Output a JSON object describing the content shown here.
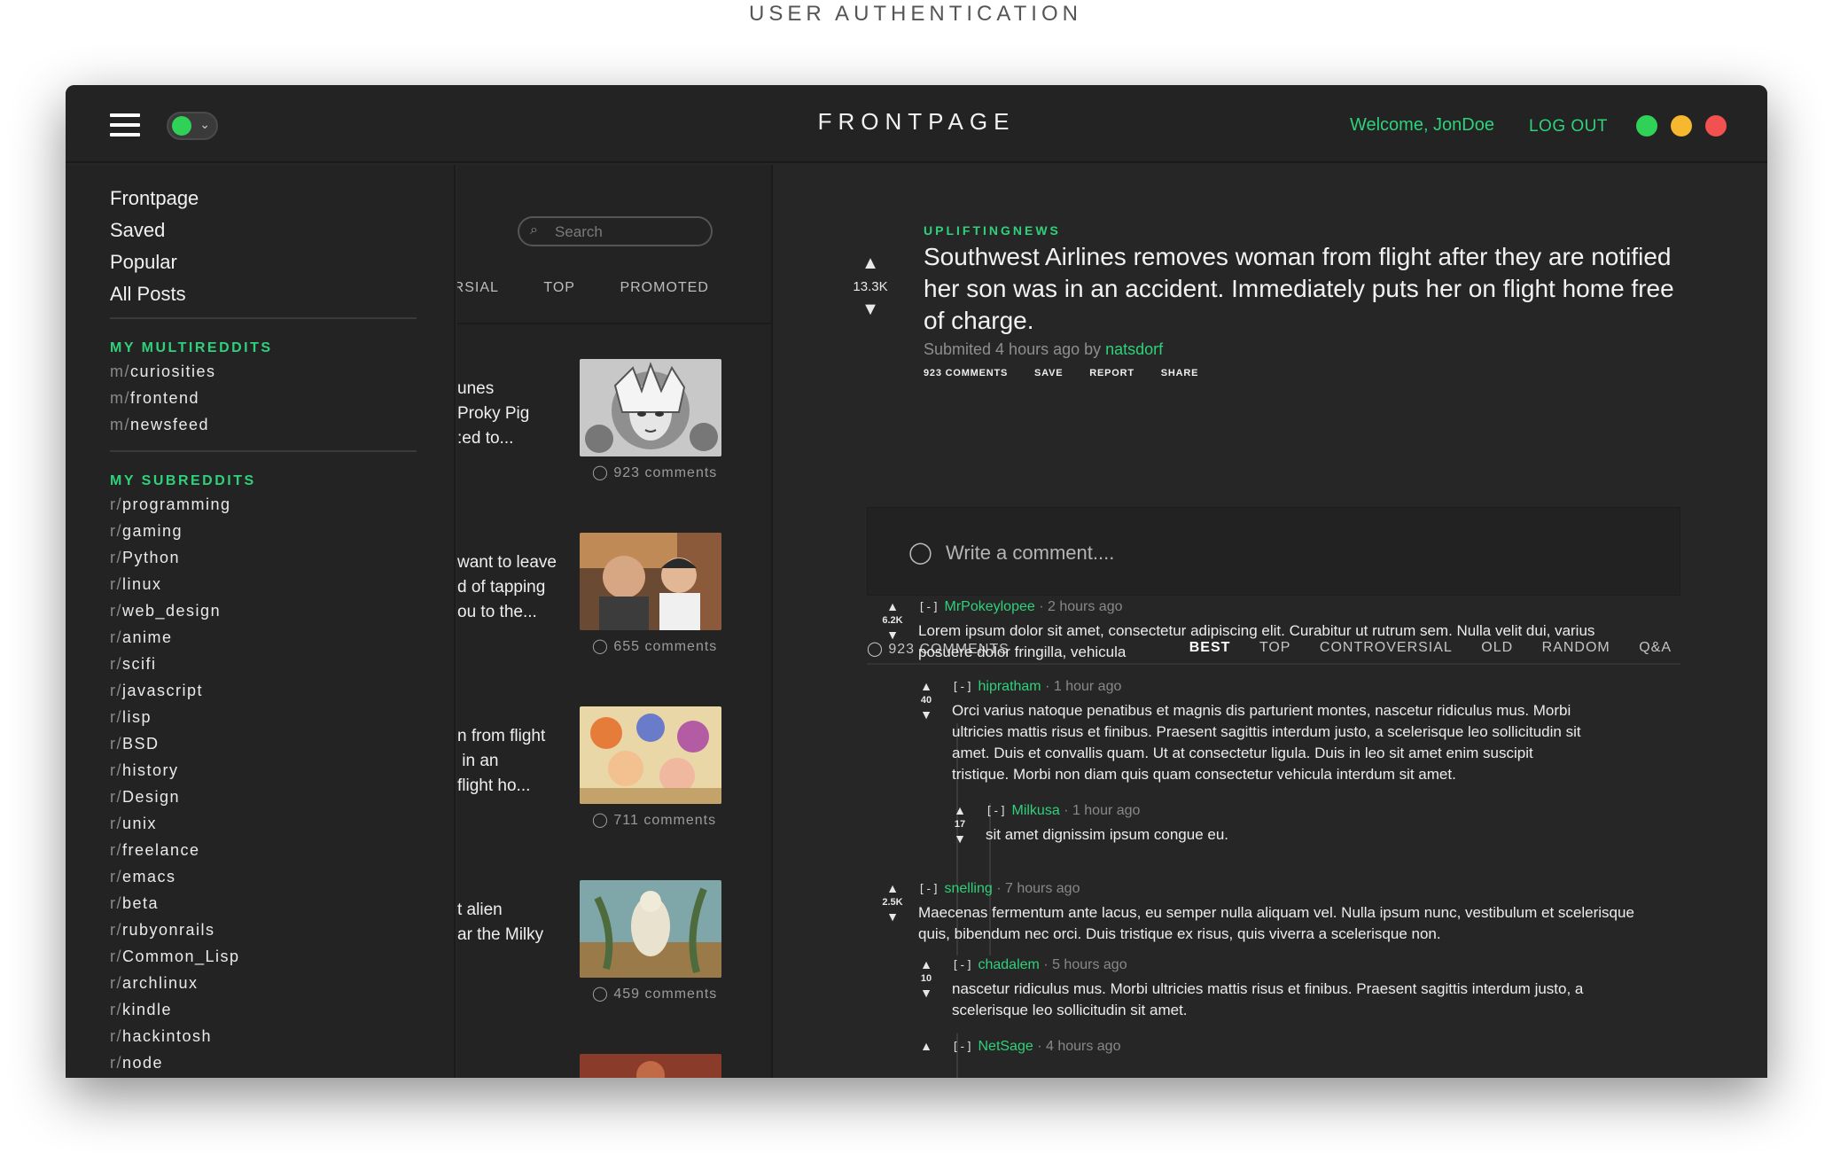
{
  "page_title": "USER AUTHENTICATION",
  "header": {
    "title": "FRONTPAGE",
    "welcome": "Welcome, JonDoe",
    "logout": "LOG OUT",
    "colors": {
      "accent": "#2fd17a",
      "traffic_green": "#2fd157",
      "traffic_yellow": "#f5b82e",
      "traffic_red": "#f1524f"
    }
  },
  "sidebar": {
    "main": [
      "Frontpage",
      "Saved",
      "Popular",
      "All Posts"
    ],
    "multis_heading": "MY MULTIREDDITS",
    "multis": [
      "curiosities",
      "frontend",
      "newsfeed"
    ],
    "multi_prefix": "m/",
    "subs_heading": "MY SUBREDDITS",
    "sub_prefix": "r/",
    "subs": [
      "programming",
      "gaming",
      "Python",
      "linux",
      "web_design",
      "anime",
      "scifi",
      "javascript",
      "lisp",
      "BSD",
      "history",
      "Design",
      "unix",
      "freelance",
      "emacs",
      "beta",
      "rubyonrails",
      "Common_Lisp",
      "archlinux",
      "kindle",
      "hackintosh",
      "node"
    ]
  },
  "list": {
    "search_placeholder": "Search",
    "tabs": [
      "ERSIAL",
      "TOP",
      "PROMOTED"
    ],
    "posts": [
      {
        "snippet": "unes\nProky Pig\n:ed to...",
        "comments": "923 comments",
        "thumb_icon": "manga-face-icon"
      },
      {
        "snippet": "want to leave\nd of tapping\nou to the...",
        "comments": "655 comments",
        "thumb_icon": "photo-icon"
      },
      {
        "snippet": "n from flight\n in an\nflight ho...",
        "comments": "711 comments",
        "thumb_icon": "anime-group-icon"
      },
      {
        "snippet": "t alien\nar the Milky",
        "comments": "459 comments",
        "thumb_icon": "painting-icon"
      }
    ]
  },
  "post": {
    "subreddit": "UPLIFTINGNEWS",
    "score": "13.3K",
    "title": "Southwest Airlines removes woman from flight after they are notified her son was in an accident. Immediately puts her on flight home free of charge.",
    "submitted_prefix": "Submited 4 hours ago by ",
    "author": "natsdorf",
    "actions": [
      "923 COMMENTS",
      "SAVE",
      "REPORT",
      "SHARE"
    ],
    "comment_placeholder": "Write a comment...."
  },
  "comments_bar": {
    "count": "923 COMMENTS",
    "sorts": [
      "BEST",
      "TOP",
      "CONTROVERSIAL",
      "OLD",
      "RANDOM",
      "Q&A"
    ],
    "active": "BEST"
  },
  "comments": [
    {
      "score": "6.2K",
      "user": "MrPokeylopee",
      "time": "2 hours ago",
      "text": "Lorem ipsum dolor sit amet, consectetur adipiscing elit. Curabitur ut rutrum sem. Nulla velit dui, varius posuere dolor fringilla, vehicula"
    },
    {
      "score": "40",
      "user": "hipratham",
      "time": "1 hour ago",
      "text": "Orci varius natoque penatibus et magnis dis parturient montes, nascetur ridiculus mus. Morbi ultricies mattis risus et finibus. Praesent sagittis interdum justo, a scelerisque leo sollicitudin sit amet. Duis et convallis quam. Ut at consectetur ligula. Duis in leo sit amet enim suscipit tristique. Morbi non diam quis quam consectetur vehicula interdum sit amet."
    },
    {
      "score": "17",
      "user": "Milkusa",
      "time": "1 hour ago",
      "text": "sit amet dignissim ipsum congue eu."
    },
    {
      "score": "2.5K",
      "user": "snelling",
      "time": "7 hours ago",
      "text": "Maecenas fermentum ante lacus, eu semper nulla aliquam vel. Nulla ipsum nunc, vestibulum et scelerisque quis, bibendum nec orci. Duis tristique ex risus, quis viverra a scelerisque non."
    },
    {
      "score": "10",
      "user": "chadalem",
      "time": "5 hours ago",
      "text": "nascetur ridiculus mus. Morbi ultricies mattis risus et finibus. Praesent sagittis interdum justo, a scelerisque leo sollicitudin sit amet."
    },
    {
      "score": "",
      "user": "NetSage",
      "time": "4 hours ago",
      "text": ""
    }
  ],
  "ui": {
    "toggle_label": "[-]",
    "sep": " · "
  }
}
